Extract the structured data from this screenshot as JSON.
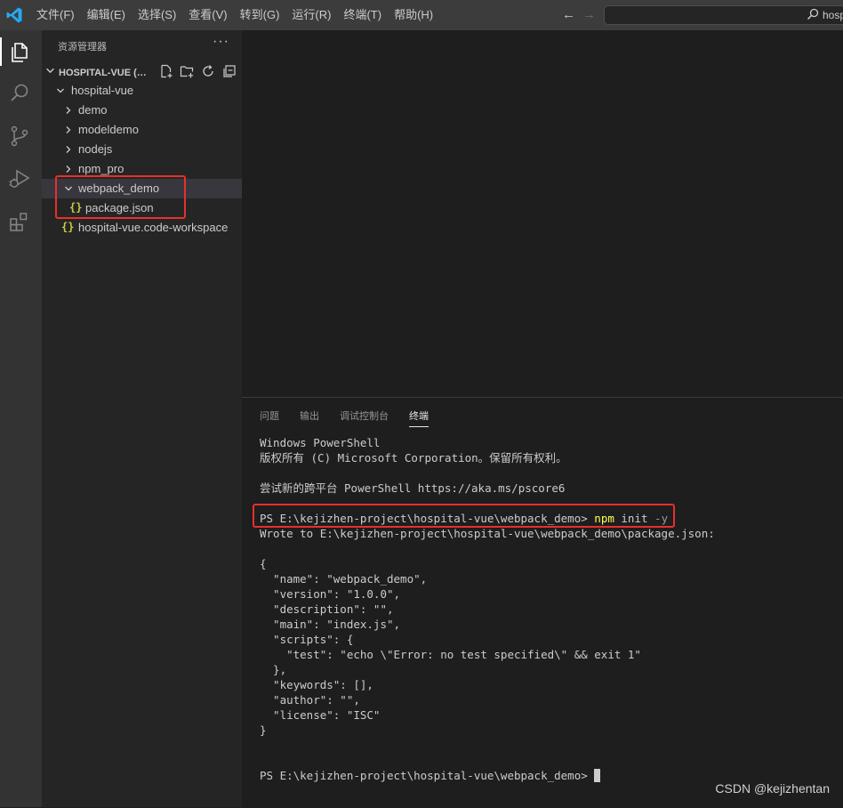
{
  "menu": [
    "文件(F)",
    "编辑(E)",
    "选择(S)",
    "查看(V)",
    "转到(G)",
    "运行(R)",
    "终端(T)",
    "帮助(H)"
  ],
  "search": {
    "text": "hosp"
  },
  "sidebar": {
    "title": "资源管理器",
    "more": "···",
    "workspace_title": "HOSPITAL-VUE (工作区)",
    "tree": [
      {
        "label": "hospital-vue",
        "type": "folder-open"
      },
      {
        "label": "demo",
        "type": "folder"
      },
      {
        "label": "modeldemo",
        "type": "folder"
      },
      {
        "label": "nodejs",
        "type": "folder"
      },
      {
        "label": "npm_pro",
        "type": "folder"
      },
      {
        "label": "webpack_demo",
        "type": "folder-open"
      },
      {
        "label": "package.json",
        "type": "json-file"
      },
      {
        "label": "hospital-vue.code-workspace",
        "type": "json-file"
      }
    ]
  },
  "panel": {
    "tabs": [
      "问题",
      "输出",
      "调试控制台",
      "终端"
    ],
    "active_tab": "终端"
  },
  "terminal": {
    "lines": [
      "Windows PowerShell",
      "版权所有 (C) Microsoft Corporation。保留所有权利。",
      "",
      "尝试新的跨平台 PowerShell https://aka.ms/pscore6",
      ""
    ],
    "prompt": "PS E:\\kejizhen-project\\hospital-vue\\webpack_demo> ",
    "cmd_npm": "npm",
    "cmd_init": " init",
    "cmd_flag": " -y",
    "output": [
      "Wrote to E:\\kejizhen-project\\hospital-vue\\webpack_demo\\package.json:",
      "",
      "{",
      "  \"name\": \"webpack_demo\",",
      "  \"version\": \"1.0.0\",",
      "  \"description\": \"\",",
      "  \"main\": \"index.js\",",
      "  \"scripts\": {",
      "    \"test\": \"echo \\\"Error: no test specified\\\" && exit 1\"",
      "  },",
      "  \"keywords\": [],",
      "  \"author\": \"\",",
      "  \"license\": \"ISC\"",
      "}",
      "",
      ""
    ],
    "final_prompt": "PS E:\\kejizhen-project\\hospital-vue\\webpack_demo> "
  },
  "watermark": "CSDN @kejizhentan",
  "colors": {
    "accent": "#23a9f2",
    "highlight": "#e8302a",
    "json": "#cbcb41"
  }
}
